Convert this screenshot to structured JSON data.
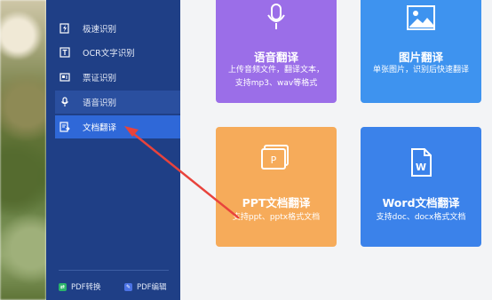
{
  "sidebar": {
    "items": [
      {
        "label": "极速识别",
        "icon": "lightning-doc-icon"
      },
      {
        "label": "OCR文字识别",
        "icon": "ocr-text-icon"
      },
      {
        "label": "票证识别",
        "icon": "ticket-icon"
      },
      {
        "label": "语音识别",
        "icon": "microphone-icon"
      },
      {
        "label": "文档翻译",
        "icon": "doc-translate-icon"
      }
    ],
    "bottom": [
      {
        "label": "PDF转换",
        "icon": "pdf-convert-icon",
        "color": "#2bb36b"
      },
      {
        "label": "PDF编辑",
        "icon": "pdf-edit-icon",
        "color": "#4b73e6"
      }
    ]
  },
  "cards": {
    "voice": {
      "title": "语音翻译",
      "desc": [
        "上传音频文件，翻译文本，",
        "支持mp3、wav等格式"
      ],
      "color": "#9b6ee8",
      "icon": "microphone-icon"
    },
    "image": {
      "title": "图片翻译",
      "desc": [
        "单张图片，识别后快速翻译"
      ],
      "color": "#3e93ef",
      "icon": "image-icon"
    },
    "ppt": {
      "title": "PPT文档翻译",
      "desc": [
        "支持ppt、pptx格式文档"
      ],
      "color": "#f6ab5a",
      "icon": "ppt-file-icon"
    },
    "word": {
      "title": "Word文档翻译",
      "desc": [
        "支持doc、docx格式文档"
      ],
      "color": "#3b82ea",
      "icon": "word-file-icon"
    }
  },
  "annotation": {
    "color": "#e8433c"
  }
}
